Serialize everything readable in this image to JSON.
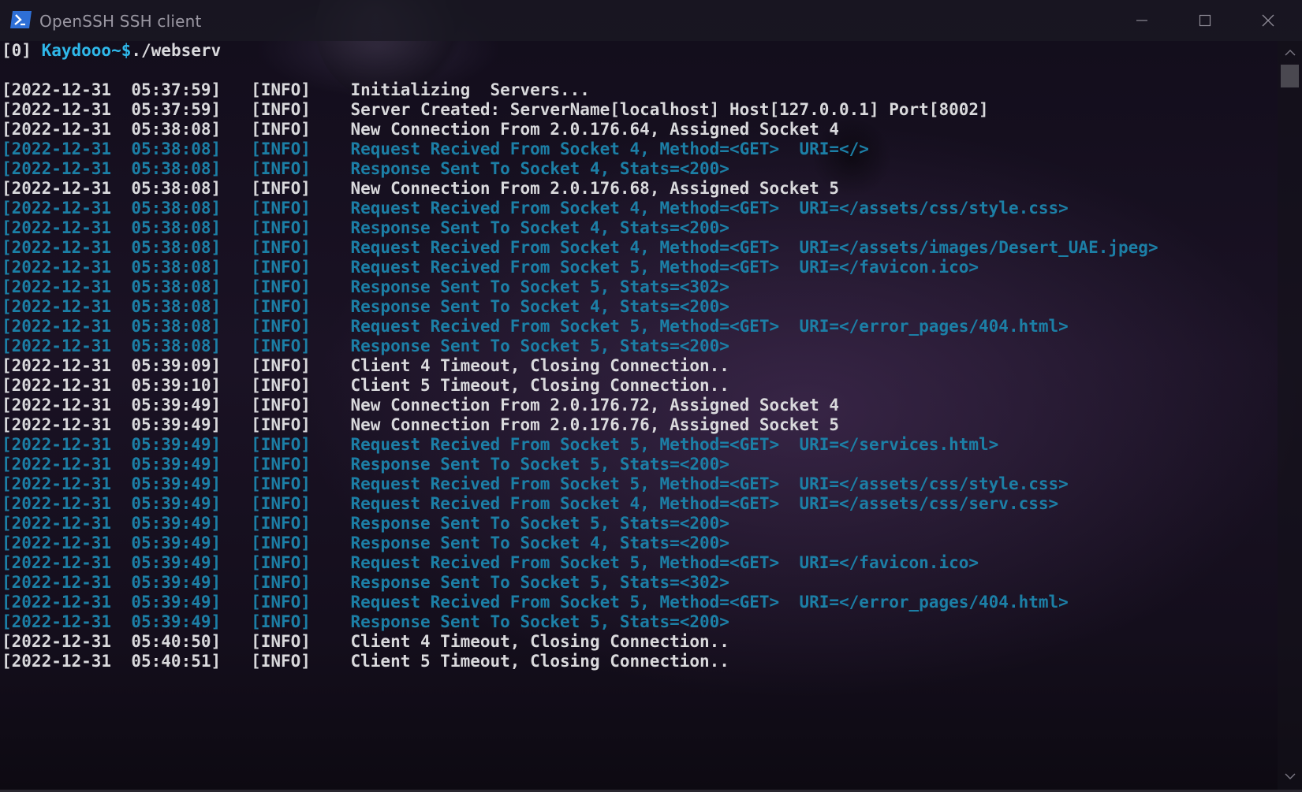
{
  "window": {
    "title": "OpenSSH SSH client"
  },
  "icons": {
    "app": "powershell-icon",
    "minimize": "minimize-icon",
    "maximize": "maximize-icon",
    "close": "close-icon"
  },
  "colors": {
    "white_text": "#d9d9dc",
    "blue_text": "#1c7fa6",
    "prompt_user": "#2fb8ea"
  },
  "prompt": {
    "index": "[0] ",
    "user": "Kaydooo~$",
    "command": "./webserv"
  },
  "log": [
    {
      "text": "",
      "style": "normal"
    },
    {
      "text": "[2022-12-31  05:37:59]   [INFO]    Initializing  Servers...",
      "style": "normal"
    },
    {
      "text": "[2022-12-31  05:37:59]   [INFO]    Server Created: ServerName[localhost] Host[127.0.0.1] Port[8002]",
      "style": "normal"
    },
    {
      "text": "[2022-12-31  05:38:08]   [INFO]    New Connection From 2.0.176.64, Assigned Socket 4",
      "style": "normal"
    },
    {
      "text": "[2022-12-31  05:38:08]   [INFO]    Request Recived From Socket 4, Method=<GET>  URI=</>",
      "style": "req"
    },
    {
      "text": "[2022-12-31  05:38:08]   [INFO]    Response Sent To Socket 4, Stats=<200>",
      "style": "req"
    },
    {
      "text": "[2022-12-31  05:38:08]   [INFO]    New Connection From 2.0.176.68, Assigned Socket 5",
      "style": "normal"
    },
    {
      "text": "[2022-12-31  05:38:08]   [INFO]    Request Recived From Socket 4, Method=<GET>  URI=</assets/css/style.css>",
      "style": "req"
    },
    {
      "text": "[2022-12-31  05:38:08]   [INFO]    Response Sent To Socket 4, Stats=<200>",
      "style": "req"
    },
    {
      "text": "[2022-12-31  05:38:08]   [INFO]    Request Recived From Socket 4, Method=<GET>  URI=</assets/images/Desert_UAE.jpeg>",
      "style": "req"
    },
    {
      "text": "[2022-12-31  05:38:08]   [INFO]    Request Recived From Socket 5, Method=<GET>  URI=</favicon.ico>",
      "style": "req"
    },
    {
      "text": "[2022-12-31  05:38:08]   [INFO]    Response Sent To Socket 5, Stats=<302>",
      "style": "req"
    },
    {
      "text": "[2022-12-31  05:38:08]   [INFO]    Response Sent To Socket 4, Stats=<200>",
      "style": "req"
    },
    {
      "text": "[2022-12-31  05:38:08]   [INFO]    Request Recived From Socket 5, Method=<GET>  URI=</error_pages/404.html>",
      "style": "req"
    },
    {
      "text": "[2022-12-31  05:38:08]   [INFO]    Response Sent To Socket 5, Stats=<200>",
      "style": "req"
    },
    {
      "text": "[2022-12-31  05:39:09]   [INFO]    Client 4 Timeout, Closing Connection..",
      "style": "normal"
    },
    {
      "text": "[2022-12-31  05:39:10]   [INFO]    Client 5 Timeout, Closing Connection..",
      "style": "normal"
    },
    {
      "text": "[2022-12-31  05:39:49]   [INFO]    New Connection From 2.0.176.72, Assigned Socket 4",
      "style": "normal"
    },
    {
      "text": "[2022-12-31  05:39:49]   [INFO]    New Connection From 2.0.176.76, Assigned Socket 5",
      "style": "normal"
    },
    {
      "text": "[2022-12-31  05:39:49]   [INFO]    Request Recived From Socket 5, Method=<GET>  URI=</services.html>",
      "style": "req"
    },
    {
      "text": "[2022-12-31  05:39:49]   [INFO]    Response Sent To Socket 5, Stats=<200>",
      "style": "req"
    },
    {
      "text": "[2022-12-31  05:39:49]   [INFO]    Request Recived From Socket 5, Method=<GET>  URI=</assets/css/style.css>",
      "style": "req"
    },
    {
      "text": "[2022-12-31  05:39:49]   [INFO]    Request Recived From Socket 4, Method=<GET>  URI=</assets/css/serv.css>",
      "style": "req"
    },
    {
      "text": "[2022-12-31  05:39:49]   [INFO]    Response Sent To Socket 5, Stats=<200>",
      "style": "req"
    },
    {
      "text": "[2022-12-31  05:39:49]   [INFO]    Response Sent To Socket 4, Stats=<200>",
      "style": "req"
    },
    {
      "text": "[2022-12-31  05:39:49]   [INFO]    Request Recived From Socket 5, Method=<GET>  URI=</favicon.ico>",
      "style": "req"
    },
    {
      "text": "[2022-12-31  05:39:49]   [INFO]    Response Sent To Socket 5, Stats=<302>",
      "style": "req"
    },
    {
      "text": "[2022-12-31  05:39:49]   [INFO]    Request Recived From Socket 5, Method=<GET>  URI=</error_pages/404.html>",
      "style": "req"
    },
    {
      "text": "[2022-12-31  05:39:49]   [INFO]    Response Sent To Socket 5, Stats=<200>",
      "style": "req"
    },
    {
      "text": "[2022-12-31  05:40:50]   [INFO]    Client 4 Timeout, Closing Connection..",
      "style": "normal"
    },
    {
      "text": "[2022-12-31  05:40:51]   [INFO]    Client 5 Timeout, Closing Connection..",
      "style": "normal"
    }
  ]
}
